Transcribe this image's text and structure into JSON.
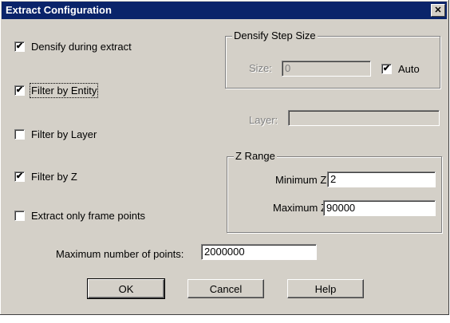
{
  "window": {
    "title": "Extract Configuration",
    "close_glyph": "✕"
  },
  "options": [
    {
      "label": "Densify during extract",
      "checked": true
    },
    {
      "label": "Filter by Entity",
      "checked": true
    },
    {
      "label": "Filter by Layer",
      "checked": false
    },
    {
      "label": "Filter by Z",
      "checked": true
    },
    {
      "label": "Extract only frame points",
      "checked": false
    }
  ],
  "densify_step": {
    "group_title": "Densify Step Size",
    "size_label": "Size:",
    "size_value": "0",
    "auto_label": "Auto",
    "auto_checked": true
  },
  "layer": {
    "label": "Layer:",
    "value": ""
  },
  "z_range": {
    "group_title": "Z Range",
    "min_label": "Minimum Z:",
    "min_value": "2",
    "max_label": "Maximum Z:",
    "max_value": "90000"
  },
  "max_points": {
    "label": "Maximum number of points:",
    "value": "2000000"
  },
  "buttons": {
    "ok": "OK",
    "cancel": "Cancel",
    "help": "Help"
  },
  "glyphs": {
    "check": "✔"
  }
}
